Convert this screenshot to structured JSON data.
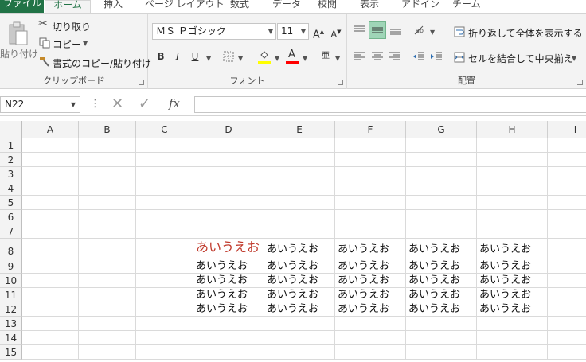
{
  "tabs": [
    "ファイル",
    "ホーム",
    "挿入",
    "ページ レイアウト",
    "数式",
    "データ",
    "校閲",
    "表示",
    "アドイン",
    "チーム"
  ],
  "clipboard": {
    "paste": "貼り付け",
    "cut": "切り取り",
    "copy": "コピー",
    "format_painter": "書式のコピー/貼り付け",
    "group_label": "クリップボード"
  },
  "font": {
    "name": "ＭＳ Ｐゴシック",
    "size": "11",
    "group_label": "フォント",
    "bold": "B",
    "italic": "I",
    "underline": "U",
    "fill_color": "#ffff00",
    "font_color": "#ff0000"
  },
  "alignment": {
    "wrap_text": "折り返して全体を表示する",
    "merge_center": "セルを結合して中央揃え",
    "group_label": "配置"
  },
  "formula_bar": {
    "name_box": "N22",
    "formula": ""
  },
  "columns": [
    "A",
    "B",
    "C",
    "D",
    "E",
    "F",
    "G",
    "H",
    "I"
  ],
  "rows": [
    "1",
    "2",
    "3",
    "4",
    "5",
    "6",
    "7",
    "8",
    "9",
    "10",
    "11",
    "12",
    "13",
    "14",
    "15"
  ],
  "cells": {
    "D8": "あいうえお",
    "E8": "あいうえお",
    "F8": "あいうえお",
    "G8": "あいうえお",
    "H8": "あいうえお",
    "D9": "あいうえお",
    "E9": "あいうえお",
    "F9": "あいうえお",
    "G9": "あいうえお",
    "H9": "あいうえお",
    "D10": "あいうえお",
    "E10": "あいうえお",
    "F10": "あいうえお",
    "G10": "あいうえお",
    "H10": "あいうえお",
    "D11": "あいうえお",
    "E11": "あいうえお",
    "F11": "あいうえお",
    "G11": "あいうえお",
    "H11": "あいうえお",
    "D12": "あいうえお",
    "E12": "あいうえお",
    "F12": "あいうえお",
    "G12": "あいうえお",
    "H12": "あいうえお"
  },
  "colors": {
    "accent": "#217346",
    "highlight_text": "#c0392b"
  }
}
